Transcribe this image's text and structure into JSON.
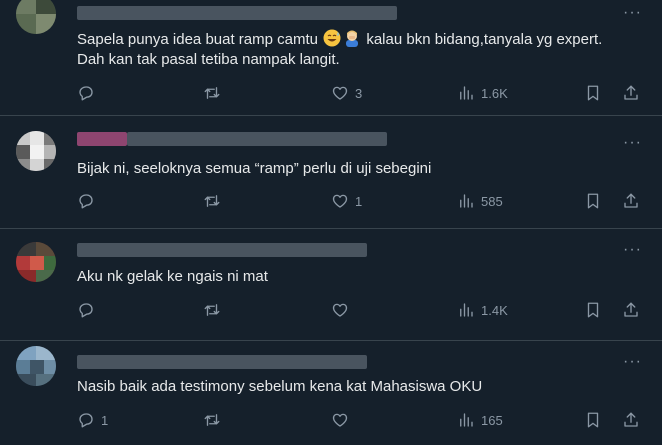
{
  "replies": [
    {
      "text_before": "Sapela punya idea buat ramp camtu ",
      "text_after": " kalau bkn bidang,tanyala yg expert. Dah kan tak pasal tetiba nampak langit.",
      "emojis": [
        "grinning-sweat-emoji",
        "person-facepalming-emoji"
      ],
      "stats": {
        "replies": "",
        "reposts": "",
        "likes": "3",
        "views": "1.6K"
      }
    },
    {
      "text": "Bijak ni, seeloknya semua “ramp” perlu di uji sebegini",
      "stats": {
        "replies": "",
        "reposts": "",
        "likes": "1",
        "views": "585"
      }
    },
    {
      "text": "Aku nk gelak ke ngais ni mat",
      "stats": {
        "replies": "",
        "reposts": "",
        "likes": "",
        "views": "1.4K"
      }
    },
    {
      "text": "Nasib baik ada testimony sebelum kena kat Mahasiswa OKU",
      "stats": {
        "replies": "1",
        "reposts": "",
        "likes": "",
        "views": "165"
      }
    }
  ],
  "more_label": "···",
  "colors": {
    "background": "#15202b",
    "text": "#e7e9ea",
    "muted": "#8b98a5",
    "divider": "#38444d"
  }
}
